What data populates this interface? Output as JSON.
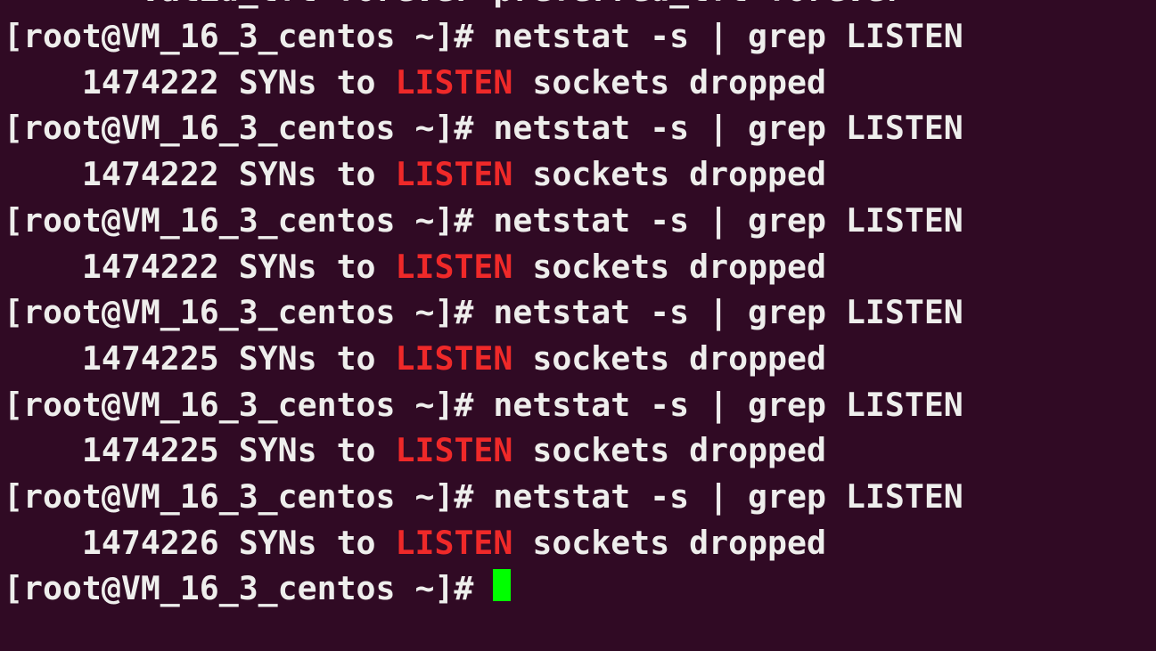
{
  "colors": {
    "background": "#300A24",
    "foreground": "#EEEEEC",
    "highlight_red": "#EF2929",
    "cursor": "#00FF00"
  },
  "prompt": "[root@VM_16_3_centos ~]# ",
  "partial_top_line": "       valid_lft forever preferred_lft forever",
  "command": "netstat -s | grep LISTEN",
  "output": {
    "indent": "    ",
    "pre": " SYNs to ",
    "match": "LISTEN",
    "post": " sockets dropped"
  },
  "runs": [
    {
      "count": "1474222"
    },
    {
      "count": "1474222"
    },
    {
      "count": "1474222"
    },
    {
      "count": "1474225"
    },
    {
      "count": "1474225"
    },
    {
      "count": "1474226"
    }
  ]
}
